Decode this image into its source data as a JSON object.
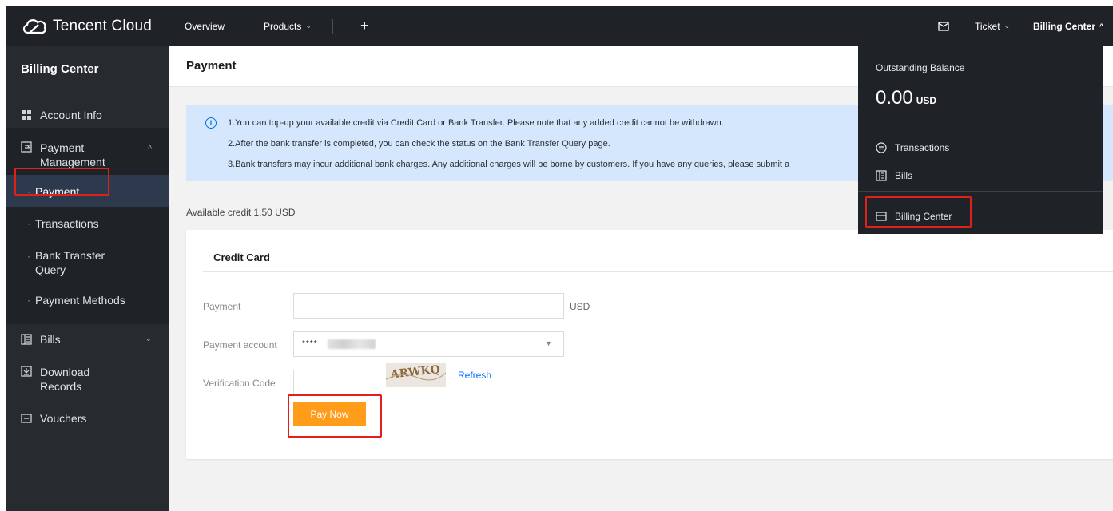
{
  "brand": {
    "name": "Tencent Cloud"
  },
  "topnav": {
    "overview": "Overview",
    "products": "Products",
    "add": "+",
    "ticket": "Ticket",
    "billing_center": "Billing Center"
  },
  "sidebar": {
    "title": "Billing Center",
    "items": {
      "account_info": "Account Info",
      "payment_management": "Payment Management",
      "bills": "Bills",
      "download_records": "Download Records",
      "vouchers": "Vouchers"
    },
    "submenu": {
      "payment": "Payment",
      "transactions": "Transactions",
      "bank_transfer_query": "Bank Transfer Query",
      "payment_methods": "Payment Methods"
    }
  },
  "page": {
    "title": "Payment",
    "notice": [
      "1.You can top-up your available credit via Credit Card or Bank Transfer. Please note that any added credit cannot be withdrawn.",
      "2.After the bank transfer is completed, you can check the status on the Bank Transfer Query page.",
      "3.Bank transfers may incur additional bank charges. Any additional charges will be borne by customers. If you have any queries, please submit a"
    ],
    "available_credit": "Available credit  1.50 USD"
  },
  "form": {
    "tab": "Credit Card",
    "payment_label": "Payment",
    "payment_value": "",
    "payment_unit": "USD",
    "account_label": "Payment account",
    "account_value": "****",
    "verification_label": "Verification Code",
    "verification_value": "",
    "captcha_text": "ARWKQ",
    "refresh": "Refresh",
    "pay_now": "Pay Now"
  },
  "dropdown": {
    "title": "Outstanding Balance",
    "amount": "0.00",
    "currency": "USD",
    "transactions": "Transactions",
    "bills": "Bills",
    "billing_center": "Billing Center"
  },
  "colors": {
    "topbar": "#1f2328",
    "sidebar": "#272b30",
    "accent": "#006eff",
    "pay_button": "#ff9c19",
    "notice_bg": "#d5e7fc",
    "highlight": "#e0201a"
  }
}
